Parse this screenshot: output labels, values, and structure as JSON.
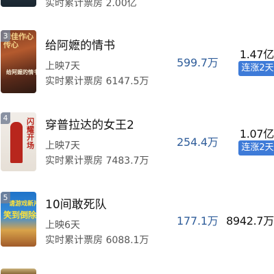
{
  "top_partial": {
    "cumulative_text": "实时累计票房 2.00亿"
  },
  "movies": [
    {
      "rank": "3",
      "title": "给阿嬷的情书",
      "days": "上映7天",
      "cumulative": "实时累计票房 6147.5万",
      "today": "599.7万",
      "total": "1.47亿",
      "badge": "连涨2天",
      "poster_text": "给阿嬷的情书",
      "poster_tagline": "碑佳作心传心"
    },
    {
      "rank": "4",
      "title": "穿普拉达的女王2",
      "days": "上映7天",
      "cumulative": "实时累计票房 7483.7万",
      "today": "254.4万",
      "total": "1.07亿",
      "badge": "连涨2天",
      "poster_text": "闪耀开场"
    },
    {
      "rank": "5",
      "title": "10间敢死队",
      "days": "上映6天",
      "cumulative": "实时累计票房 6088.1万",
      "today": "177.1万",
      "total": "8942.7万",
      "poster_text": "请游戏新片",
      "poster_tagline": "笑到倒除"
    }
  ],
  "colors": {
    "accent_blue": "#2f5d9a",
    "badge_blue": "#3e7bd8"
  }
}
